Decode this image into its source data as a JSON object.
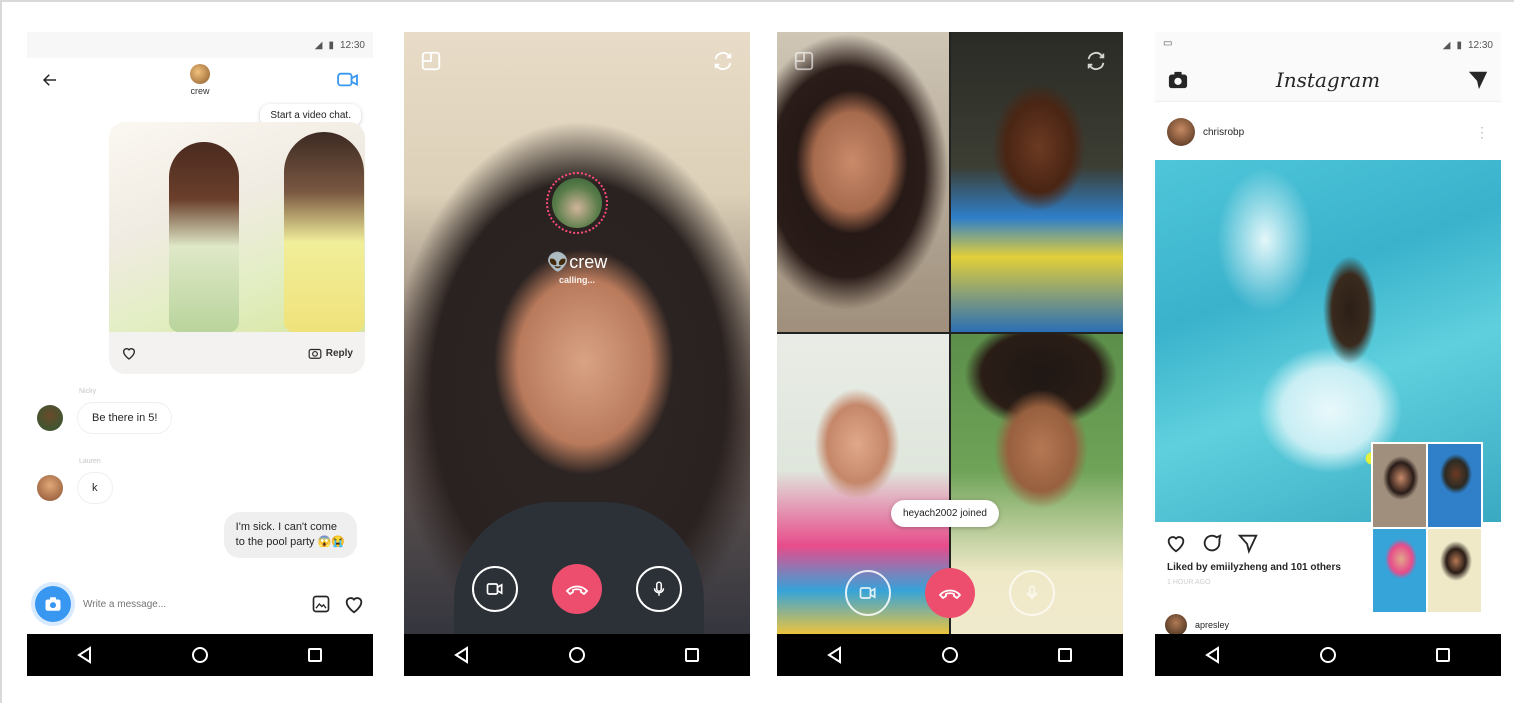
{
  "status": {
    "time": "12:30"
  },
  "thread": {
    "group_name": "crew",
    "tooltip": "Start a video chat.",
    "reply_label": "Reply",
    "sender_1": "Nicky",
    "message_1": "Be there in 5!",
    "sender_2": "Lauren",
    "message_2": "k",
    "message_3_line1": "I'm sick. I can't come",
    "message_3_line2": "to the pool party 😱😭",
    "composer_placeholder": "Write a message..."
  },
  "calling": {
    "name": "crew",
    "status": "calling..."
  },
  "group_call": {
    "toast": "heyach2002 joined"
  },
  "feed": {
    "logo": "Instagram",
    "username": "chrisrobp",
    "likes": "Liked by emiilyzheng and 101 others",
    "time_ago": "1 HOUR AGO",
    "commenter": "apresley"
  },
  "colors": {
    "accent_blue": "#3897f0",
    "end_call_pink": "#ed4e6e",
    "caller_ring": "#ff4a7a"
  }
}
